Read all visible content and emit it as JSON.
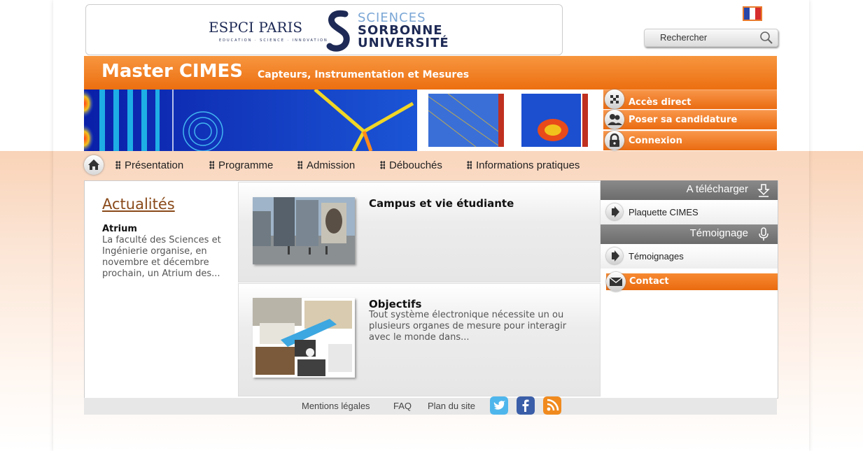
{
  "header": {
    "logo_espci_text": "ESPCI PARIS",
    "logo_espci_tagline": "EDUCATION · SCIENCE · INNOVATION",
    "logo_su_line1": "SCIENCES",
    "logo_su_line2": "SORBONNE",
    "logo_su_line3": "UNIVERSITÉ",
    "language_flag": "fr-flag",
    "search": {
      "placeholder": "Rechercher",
      "value": ""
    },
    "title": "Master CIMES",
    "subtitle": "Capteurs, Instrumentation et Mesures"
  },
  "quick_links": [
    {
      "label": "Accès direct",
      "icon": "grid-icon"
    },
    {
      "label": "Poser sa candidature",
      "icon": "users-icon"
    },
    {
      "label": "Connexion",
      "icon": "lock-icon"
    }
  ],
  "nav": {
    "home_icon": "home-icon",
    "items": [
      {
        "label": "Présentation"
      },
      {
        "label": "Programme"
      },
      {
        "label": "Admission"
      },
      {
        "label": "Débouchés"
      },
      {
        "label": "Informations pratiques"
      }
    ]
  },
  "news": {
    "title": "Actualités",
    "item_title": "Atrium",
    "item_text": "La faculté des Sciences et Ingénierie organise, en novembre et décembre prochain, un Atrium des..."
  },
  "cards": [
    {
      "title": "Campus et vie étudiante",
      "text": ""
    },
    {
      "title": "Objectifs",
      "text": "Tout système électronique nécessite un ou plusieurs organes de mesure pour interagir avec le monde dans..."
    }
  ],
  "sidebar": {
    "download_header": "A télécharger",
    "download_link": "Plaquette CIMES",
    "testimony_header": "Témoignage",
    "testimony_link": "Témoignages",
    "contact_label": "Contact"
  },
  "footer": {
    "links": [
      "Mentions légales",
      "FAQ",
      "Plan du site"
    ],
    "social": [
      "twitter-icon",
      "facebook-icon",
      "rss-icon"
    ]
  },
  "colors": {
    "accent": "#ec6f10",
    "link": "#8a4a1a"
  }
}
